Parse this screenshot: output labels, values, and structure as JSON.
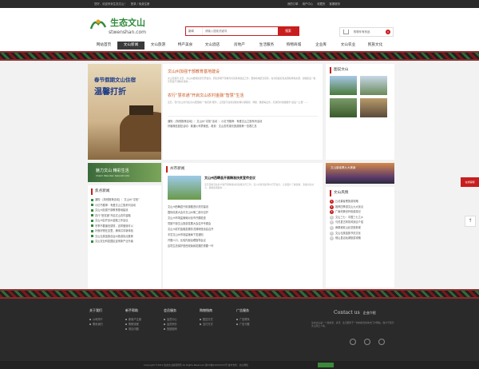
{
  "topbar": {
    "left": [
      "您好，欢迎来到生态文山！",
      "登录 / 免费注册"
    ],
    "right": [
      "我的订单",
      "用户中心",
      "收藏夹",
      "客服服务"
    ]
  },
  "logo": {
    "cn": "生态文山",
    "url": "stwenshan.com"
  },
  "search": {
    "category": "新闻",
    "placeholder": "请输入搜索关键词",
    "button": "搜索"
  },
  "cart": {
    "label": "购物车有商品",
    "count": "0"
  },
  "nav": [
    "网站首页",
    "文山新闻",
    "文山旅游",
    "特产美食",
    "文山酒店",
    "房地产",
    "生活服务",
    "购物商城",
    "企业库",
    "文山农业",
    "民族文化"
  ],
  "banner": {
    "line1": "春节假期文山住宿",
    "line2": "温馨打折"
  },
  "news1": {
    "headline": "文山州加强干部教育基地建设",
    "desc": "文山日报讯 近日，文山州委组织部召开会议，研究部署干部教育培训基地建设工作，要求各地结合实际，充分挖掘红色资源和特色资源，加快建设一批示范性干部教育基地……",
    "headline2": "农行“慧农通”开启文山农村金融“智慧”生活",
    "desc2": "近日，农行文山分行在全州范围推广“惠农通”服务，让农民不出村就能办理小额取款、转账、缴费等业务，打通农村金融服务“最后一公里”……",
    "links": [
      "通知：[特别推荐活动] ｜ 文山州“寻找”活动 ｜ 小红书推荐：有爱文山之旅系列活动",
      "好客微信回复活动：普通火车票便宜，看景：文山农村观光旅游推荐一览表汇总"
    ]
  },
  "right1": {
    "title": "图说文山"
  },
  "banner2": {
    "text": "魅力文山 精彩生活",
    "sub": "Charm Wenshan Splendid Life"
  },
  "hot": {
    "title": "焦点新闻",
    "items": [
      "通知：[特别推荐活动] ｜ 文山州“寻找”",
      "小红书推荐：有爱文山之旅系列活动",
      "文山州加强干部教育基地建设",
      "农行“慧农通”开启文山农村金融",
      "文山州召开全州金融工作会议",
      "冬季不要害怕感冒，这样做就可以",
      "好食好物在这里，美味共享新体验",
      "文山壮族苗族自治州旅游景点推荐",
      "文山农业科技园区迎来新产业升级"
    ]
  },
  "citynews": {
    "title": "州市新闻",
    "feat_title": "文山州西畴县开展精准扶贫宣传会议",
    "feat_desc": "近日西畴县在各乡镇开展精准扶贫政策宣传工作，深入村寨组织群众召开会议，让贫困户了解政策，激发内生动力，确保如期脱贫……",
    "items": [
      "文山州西畴县兴街镇推进示范村建设",
      "国际民族大会中文山州第二部分召开",
      "文山州市场监管局对全市开展检查",
      "党团干部文山旅游发展大会召开专题会",
      "文山州农村金融发展情况调研座谈会召开",
      "丰富文山州市场监管局下发通知",
      "开展人口、比较内部治理指导会议",
      "边境生态保护是西双版纳发展的重要一环"
    ]
  },
  "right2": {
    "banner": "文山普者黑九大美景",
    "title": "文山风情",
    "items": [
      "丘北普者黑旅游攻略",
      "推荐四季游文山九大景点",
      "广南坝美世外桃源游记",
      "文山三七：中国三七之乡",
      "马关县古林箐风景区介绍",
      "麻栗坡老山纪念馆参观",
      "文山壮族苗族节庆文化",
      "砚山县浴仙湖旅游攻略"
    ]
  },
  "floatbtn": "在线客服",
  "totop": "↑",
  "footer": {
    "cols": [
      {
        "title": "关于我们",
        "links": [
          "公司简介",
          "联系我们"
        ]
      },
      {
        "title": "新手帮助",
        "links": [
          "新用户注册",
          "购物流程",
          "常见问题"
        ]
      },
      {
        "title": "会员服务",
        "links": [
          "会员中心",
          "会员积分",
          "找回密码"
        ]
      },
      {
        "title": "购物指南",
        "links": [
          "配送方式",
          "支付方式"
        ]
      },
      {
        "title": "广告服务",
        "links": [
          "广告联系",
          "广告刊登"
        ]
      }
    ],
    "contact_title": "Contact us",
    "contact_sub": "企业介绍",
    "contact_desc": "生态文山是一个集旅游、资讯、生活服务于一体的综合性地方门户网站，致力于展示文山风土人情。",
    "copyright": "Copyright ©2014 生态文山版权所有 All Rights Reserved  滇ICP备XXXXXXXX号  技术支持：文山网络"
  },
  "colors": {
    "brand_red": "#c81e1e",
    "brand_green": "#2e8b3a",
    "title_orange": "#c8541a"
  }
}
